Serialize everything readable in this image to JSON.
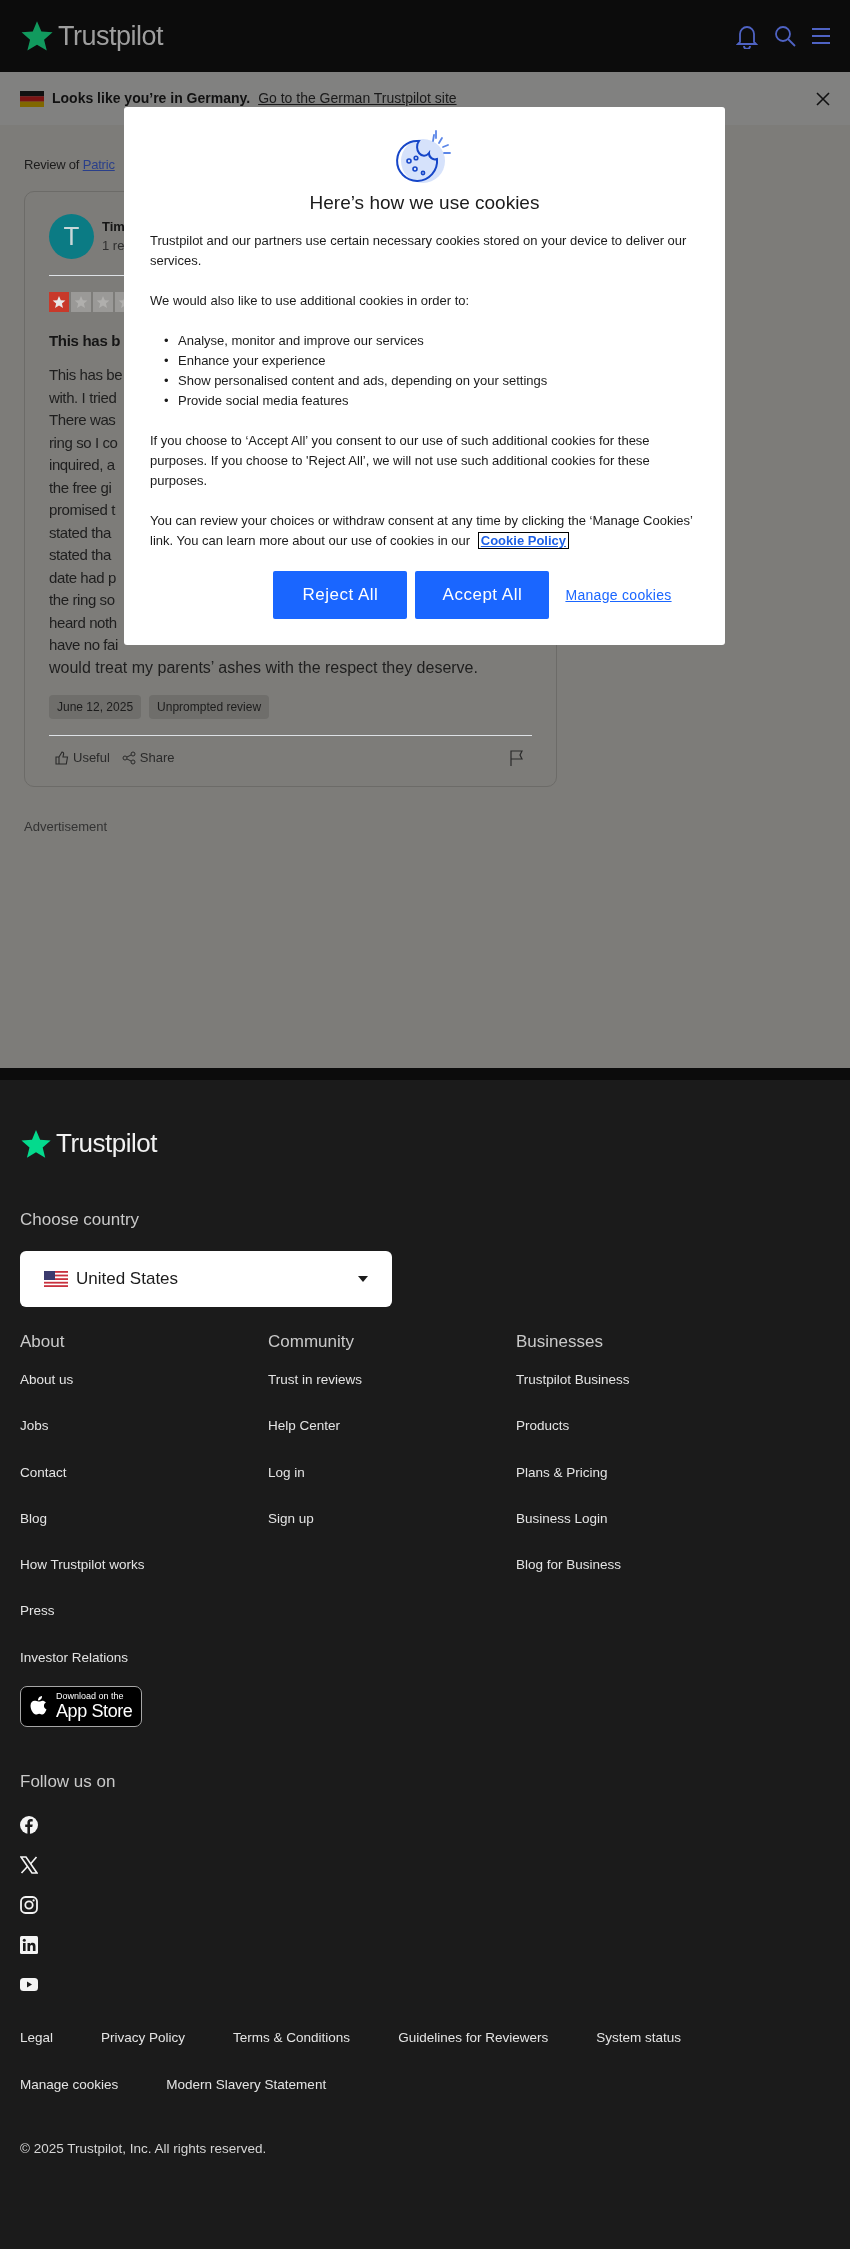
{
  "header": {
    "logo": "Trustpilot"
  },
  "banner": {
    "message": "Looks like you’re in Germany.",
    "link": "Go to the German Trustpilot site"
  },
  "review": {
    "prefix": "Review of",
    "company_link": "Patric",
    "reviewer": {
      "initial": "T",
      "name": "Tim",
      "count": "1 re"
    },
    "stars": 1,
    "title": "This has b",
    "body_lines": [
      "This has be",
      "with. I tried",
      "There was",
      "ring so I co",
      "inquired, a",
      "the free gi",
      "promised t",
      "stated tha",
      "stated tha",
      "date had p",
      "the ring so",
      "heard noth",
      "have no fai",
      "would treat my parents’ ashes with the respect they deserve."
    ],
    "tags": [
      "June 12, 2025",
      "Unprompted review"
    ],
    "actions": [
      {
        "kind": "like",
        "label": "Useful"
      },
      {
        "kind": "share",
        "label": "Share"
      }
    ]
  },
  "advertisement": "Advertisement",
  "cookie_dialog": {
    "title": "Here’s how we use cookies",
    "intro": "Trustpilot and our partners use certain necessary cookies stored on your device to deliver our services.",
    "lead": "We would also like to use additional cookies in order to:",
    "purposes": [
      {
        "bullet": "•",
        "text": "Analyse, monitor and improve our services"
      },
      {
        "bullet": "•",
        "text": "Enhance your experience"
      },
      {
        "bullet": "•",
        "text": "Show personalised content and ads, depending on your settings"
      },
      {
        "bullet": "•",
        "text": "Provide social media features"
      }
    ],
    "consent": "If you choose to ‘Accept All’ you consent to our use of such additional cookies for these purposes. If you choose to 'Reject All’, we will not use such additional cookies for these purposes.",
    "review_text": "You can review your choices or withdraw consent at any time by clicking the ‘Manage Cookies’ link. You can learn more about our use of cookies in our",
    "policy_link": "Cookie Policy",
    "buttons": [
      "Reject All",
      "Accept All"
    ],
    "manage_link": "Manage cookies"
  },
  "footer": {
    "logo": "Trustpilot",
    "country_label": "Choose country",
    "country": "United States",
    "columns": [
      {
        "heading": "About",
        "links": [
          "About us",
          "Jobs",
          "Contact",
          "Blog",
          "How Trustpilot works",
          "Press",
          "Investor Relations"
        ]
      },
      {
        "heading": "Community",
        "links": [
          "Trust in reviews",
          "Help Center",
          "Log in",
          "Sign up"
        ]
      },
      {
        "heading": "Businesses",
        "links": [
          "Trustpilot Business",
          "Products",
          "Plans & Pricing",
          "Business Login",
          "Blog for Business"
        ]
      }
    ],
    "app_store": {
      "small": "Download on the",
      "big": "App Store"
    },
    "follow": "Follow us on",
    "legal_links": [
      "Legal",
      "Privacy Policy",
      "Terms & Conditions",
      "Guidelines for Reviewers",
      "System status",
      "Manage cookies",
      "Modern Slavery Statement"
    ],
    "copyright": "© 2025 Trustpilot, Inc. All rights reserved."
  }
}
